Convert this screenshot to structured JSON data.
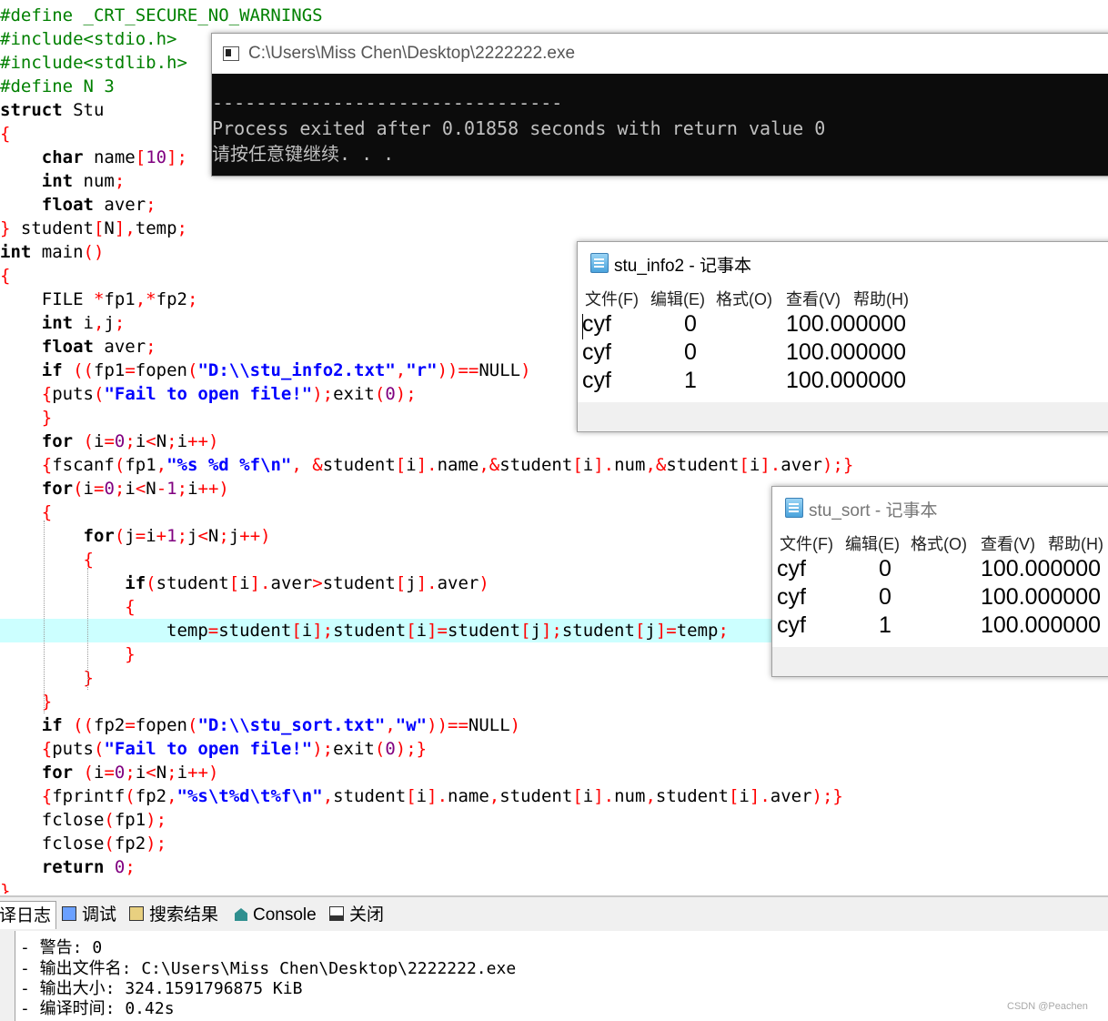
{
  "editor": {
    "highlight_line": 26,
    "lines": [
      [
        [
          "pre",
          "#define _CRT_SECURE_NO_WARNINGS"
        ]
      ],
      [
        [
          "pre",
          "#include<stdio.h>"
        ]
      ],
      [
        [
          "pre",
          "#include<stdlib.h>"
        ]
      ],
      [
        [
          "pre",
          "#define N 3"
        ]
      ],
      [
        [
          "kw",
          "struct"
        ],
        [
          "id",
          " Stu"
        ]
      ],
      [
        [
          "sym",
          "{"
        ]
      ],
      [
        [
          "id",
          "    "
        ],
        [
          "kw",
          "char"
        ],
        [
          "id",
          " name"
        ],
        [
          "sym",
          "["
        ],
        [
          "num",
          "10"
        ],
        [
          "sym",
          "];"
        ]
      ],
      [
        [
          "id",
          "    "
        ],
        [
          "kw",
          "int"
        ],
        [
          "id",
          " num"
        ],
        [
          "sym",
          ";"
        ]
      ],
      [
        [
          "id",
          "    "
        ],
        [
          "kw",
          "float"
        ],
        [
          "id",
          " aver"
        ],
        [
          "sym",
          ";"
        ]
      ],
      [
        [
          "sym",
          "}"
        ],
        [
          "id",
          " student"
        ],
        [
          "sym",
          "["
        ],
        [
          "id",
          "N"
        ],
        [
          "sym",
          "],"
        ],
        [
          "id",
          "temp"
        ],
        [
          "sym",
          ";"
        ]
      ],
      [
        [
          "kw",
          "int"
        ],
        [
          "id",
          " main"
        ],
        [
          "sym",
          "()"
        ]
      ],
      [
        [
          "sym",
          "{"
        ]
      ],
      [
        [
          "id",
          "    FILE "
        ],
        [
          "sym",
          "*"
        ],
        [
          "id",
          "fp1"
        ],
        [
          "sym",
          ",*"
        ],
        [
          "id",
          "fp2"
        ],
        [
          "sym",
          ";"
        ]
      ],
      [
        [
          "id",
          "    "
        ],
        [
          "kw",
          "int"
        ],
        [
          "id",
          " i"
        ],
        [
          "sym",
          ","
        ],
        [
          "id",
          "j"
        ],
        [
          "sym",
          ";"
        ]
      ],
      [
        [
          "id",
          "    "
        ],
        [
          "kw",
          "float"
        ],
        [
          "id",
          " aver"
        ],
        [
          "sym",
          ";"
        ]
      ],
      [
        [
          "id",
          "    "
        ],
        [
          "kw",
          "if"
        ],
        [
          "id",
          " "
        ],
        [
          "sym",
          "(("
        ],
        [
          "id",
          "fp1"
        ],
        [
          "sym",
          "="
        ],
        [
          "id",
          "fopen"
        ],
        [
          "sym",
          "("
        ],
        [
          "str",
          "\"D:\\\\stu_info2.txt\""
        ],
        [
          "sym",
          ","
        ],
        [
          "str",
          "\"r\""
        ],
        [
          "sym",
          "))=="
        ],
        [
          "id",
          "NULL"
        ],
        [
          "sym",
          ")"
        ]
      ],
      [
        [
          "id",
          "    "
        ],
        [
          "sym",
          "{"
        ],
        [
          "id",
          "puts"
        ],
        [
          "sym",
          "("
        ],
        [
          "str",
          "\"Fail to open file!\""
        ],
        [
          "sym",
          ");"
        ],
        [
          "id",
          "exit"
        ],
        [
          "sym",
          "("
        ],
        [
          "num",
          "0"
        ],
        [
          "sym",
          ");"
        ]
      ],
      [
        [
          "id",
          "    "
        ],
        [
          "sym",
          "}"
        ]
      ],
      [
        [
          "id",
          "    "
        ],
        [
          "kw",
          "for"
        ],
        [
          "id",
          " "
        ],
        [
          "sym",
          "("
        ],
        [
          "id",
          "i"
        ],
        [
          "sym",
          "="
        ],
        [
          "num",
          "0"
        ],
        [
          "sym",
          ";"
        ],
        [
          "id",
          "i"
        ],
        [
          "sym",
          "<"
        ],
        [
          "id",
          "N"
        ],
        [
          "sym",
          ";"
        ],
        [
          "id",
          "i"
        ],
        [
          "sym",
          "++)"
        ]
      ],
      [
        [
          "id",
          "    "
        ],
        [
          "sym",
          "{"
        ],
        [
          "id",
          "fscanf"
        ],
        [
          "sym",
          "("
        ],
        [
          "id",
          "fp1"
        ],
        [
          "sym",
          ","
        ],
        [
          "str",
          "\"%s %d %f\\n\""
        ],
        [
          "sym",
          ", &"
        ],
        [
          "id",
          "student"
        ],
        [
          "sym",
          "["
        ],
        [
          "id",
          "i"
        ],
        [
          "sym",
          "]."
        ],
        [
          "id",
          "name"
        ],
        [
          "sym",
          ",&"
        ],
        [
          "id",
          "student"
        ],
        [
          "sym",
          "["
        ],
        [
          "id",
          "i"
        ],
        [
          "sym",
          "]."
        ],
        [
          "id",
          "num"
        ],
        [
          "sym",
          ",&"
        ],
        [
          "id",
          "student"
        ],
        [
          "sym",
          "["
        ],
        [
          "id",
          "i"
        ],
        [
          "sym",
          "]."
        ],
        [
          "id",
          "aver"
        ],
        [
          "sym",
          ");}"
        ]
      ],
      [
        [
          "id",
          "    "
        ],
        [
          "kw",
          "for"
        ],
        [
          "sym",
          "("
        ],
        [
          "id",
          "i"
        ],
        [
          "sym",
          "="
        ],
        [
          "num",
          "0"
        ],
        [
          "sym",
          ";"
        ],
        [
          "id",
          "i"
        ],
        [
          "sym",
          "<"
        ],
        [
          "id",
          "N"
        ],
        [
          "sym",
          "-"
        ],
        [
          "num",
          "1"
        ],
        [
          "sym",
          ";"
        ],
        [
          "id",
          "i"
        ],
        [
          "sym",
          "++)"
        ]
      ],
      [
        [
          "id",
          "    "
        ],
        [
          "sym",
          "{"
        ]
      ],
      [
        [
          "id",
          "        "
        ],
        [
          "kw",
          "for"
        ],
        [
          "sym",
          "("
        ],
        [
          "id",
          "j"
        ],
        [
          "sym",
          "="
        ],
        [
          "id",
          "i"
        ],
        [
          "sym",
          "+"
        ],
        [
          "num",
          "1"
        ],
        [
          "sym",
          ";"
        ],
        [
          "id",
          "j"
        ],
        [
          "sym",
          "<"
        ],
        [
          "id",
          "N"
        ],
        [
          "sym",
          ";"
        ],
        [
          "id",
          "j"
        ],
        [
          "sym",
          "++)"
        ]
      ],
      [
        [
          "id",
          "        "
        ],
        [
          "sym",
          "{"
        ]
      ],
      [
        [
          "id",
          "            "
        ],
        [
          "kw",
          "if"
        ],
        [
          "sym",
          "("
        ],
        [
          "id",
          "student"
        ],
        [
          "sym",
          "["
        ],
        [
          "id",
          "i"
        ],
        [
          "sym",
          "]."
        ],
        [
          "id",
          "aver"
        ],
        [
          "sym",
          ">"
        ],
        [
          "id",
          "student"
        ],
        [
          "sym",
          "["
        ],
        [
          "id",
          "j"
        ],
        [
          "sym",
          "]."
        ],
        [
          "id",
          "aver"
        ],
        [
          "sym",
          ")"
        ]
      ],
      [
        [
          "id",
          "            "
        ],
        [
          "sym",
          "{"
        ]
      ],
      [
        [
          "id",
          "                temp"
        ],
        [
          "sym",
          "="
        ],
        [
          "id",
          "student"
        ],
        [
          "sym",
          "["
        ],
        [
          "id",
          "i"
        ],
        [
          "sym",
          "];"
        ],
        [
          "id",
          "student"
        ],
        [
          "sym",
          "["
        ],
        [
          "id",
          "i"
        ],
        [
          "sym",
          "]="
        ],
        [
          "id",
          "student"
        ],
        [
          "sym",
          "["
        ],
        [
          "id",
          "j"
        ],
        [
          "sym",
          "];"
        ],
        [
          "id",
          "student"
        ],
        [
          "sym",
          "["
        ],
        [
          "id",
          "j"
        ],
        [
          "sym",
          "]="
        ],
        [
          "id",
          "temp"
        ],
        [
          "sym",
          ";"
        ]
      ],
      [
        [
          "id",
          "            "
        ],
        [
          "sym",
          "}"
        ]
      ],
      [
        [
          "id",
          "        "
        ],
        [
          "sym",
          "}"
        ]
      ],
      [
        [
          "id",
          "    "
        ],
        [
          "sym",
          "}"
        ]
      ],
      [
        [
          "id",
          "    "
        ],
        [
          "kw",
          "if"
        ],
        [
          "id",
          " "
        ],
        [
          "sym",
          "(("
        ],
        [
          "id",
          "fp2"
        ],
        [
          "sym",
          "="
        ],
        [
          "id",
          "fopen"
        ],
        [
          "sym",
          "("
        ],
        [
          "str",
          "\"D:\\\\stu_sort.txt\""
        ],
        [
          "sym",
          ","
        ],
        [
          "str",
          "\"w\""
        ],
        [
          "sym",
          "))=="
        ],
        [
          "id",
          "NULL"
        ],
        [
          "sym",
          ")"
        ]
      ],
      [
        [
          "id",
          "    "
        ],
        [
          "sym",
          "{"
        ],
        [
          "id",
          "puts"
        ],
        [
          "sym",
          "("
        ],
        [
          "str",
          "\"Fail to open file!\""
        ],
        [
          "sym",
          ");"
        ],
        [
          "id",
          "exit"
        ],
        [
          "sym",
          "("
        ],
        [
          "num",
          "0"
        ],
        [
          "sym",
          ");}"
        ]
      ],
      [
        [
          "id",
          "    "
        ],
        [
          "kw",
          "for"
        ],
        [
          "id",
          " "
        ],
        [
          "sym",
          "("
        ],
        [
          "id",
          "i"
        ],
        [
          "sym",
          "="
        ],
        [
          "num",
          "0"
        ],
        [
          "sym",
          ";"
        ],
        [
          "id",
          "i"
        ],
        [
          "sym",
          "<"
        ],
        [
          "id",
          "N"
        ],
        [
          "sym",
          ";"
        ],
        [
          "id",
          "i"
        ],
        [
          "sym",
          "++)"
        ]
      ],
      [
        [
          "id",
          "    "
        ],
        [
          "sym",
          "{"
        ],
        [
          "id",
          "fprintf"
        ],
        [
          "sym",
          "("
        ],
        [
          "id",
          "fp2"
        ],
        [
          "sym",
          ","
        ],
        [
          "str",
          "\"%s\\t%d\\t%f\\n\""
        ],
        [
          "sym",
          ","
        ],
        [
          "id",
          "student"
        ],
        [
          "sym",
          "["
        ],
        [
          "id",
          "i"
        ],
        [
          "sym",
          "]."
        ],
        [
          "id",
          "name"
        ],
        [
          "sym",
          ","
        ],
        [
          "id",
          "student"
        ],
        [
          "sym",
          "["
        ],
        [
          "id",
          "i"
        ],
        [
          "sym",
          "]."
        ],
        [
          "id",
          "num"
        ],
        [
          "sym",
          ","
        ],
        [
          "id",
          "student"
        ],
        [
          "sym",
          "["
        ],
        [
          "id",
          "i"
        ],
        [
          "sym",
          "]."
        ],
        [
          "id",
          "aver"
        ],
        [
          "sym",
          ");}"
        ]
      ],
      [
        [
          "id",
          "    fclose"
        ],
        [
          "sym",
          "("
        ],
        [
          "id",
          "fp1"
        ],
        [
          "sym",
          ");"
        ]
      ],
      [
        [
          "id",
          "    fclose"
        ],
        [
          "sym",
          "("
        ],
        [
          "id",
          "fp2"
        ],
        [
          "sym",
          ");"
        ]
      ],
      [
        [
          "id",
          "    "
        ],
        [
          "kw",
          "return"
        ],
        [
          "id",
          " "
        ],
        [
          "num",
          "0"
        ],
        [
          "sym",
          ";"
        ]
      ],
      [
        [
          "sym",
          "}"
        ]
      ]
    ]
  },
  "console": {
    "title": "C:\\Users\\Miss Chen\\Desktop\\2222222.exe",
    "lines": [
      "--------------------------------",
      "Process exited after 0.01858 seconds with return value 0",
      "请按任意键继续. . ."
    ],
    "icon": "console-window-icon"
  },
  "notepad_info2": {
    "title": "stu_info2 - 记事本",
    "menu": [
      "文件(F)",
      "编辑(E)",
      "格式(O)",
      "查看(V)",
      "帮助(H)"
    ],
    "rows": [
      {
        "name": "cyf",
        "num": "0",
        "aver": "100.000000"
      },
      {
        "name": "cyf",
        "num": "0",
        "aver": "100.000000"
      },
      {
        "name": "cyf",
        "num": "1",
        "aver": "100.000000"
      }
    ],
    "title_color": "#000000"
  },
  "notepad_sort": {
    "title": "stu_sort - 记事本",
    "menu": [
      "文件(F)",
      "编辑(E)",
      "格式(O)",
      "查看(V)",
      "帮助(H)"
    ],
    "rows": [
      {
        "name": "cyf",
        "num": "0",
        "aver": "100.000000"
      },
      {
        "name": "cyf",
        "num": "0",
        "aver": "100.000000"
      },
      {
        "name": "cyf",
        "num": "1",
        "aver": "100.000000"
      }
    ],
    "title_color": "#777777"
  },
  "bottom_tabs": [
    {
      "label": "译日志",
      "icon": "",
      "active": true
    },
    {
      "label": "调试",
      "icon": "debug-icon",
      "active": false
    },
    {
      "label": "搜索结果",
      "icon": "search-results-icon",
      "active": false
    },
    {
      "label": "Console",
      "icon": "console-icon",
      "active": false
    },
    {
      "label": "关闭",
      "icon": "close-icon",
      "active": false
    }
  ],
  "compile_log": [
    "- 警告: 0",
    "- 输出文件名: C:\\Users\\Miss Chen\\Desktop\\2222222.exe",
    "- 输出大小: 324.1591796875 KiB",
    "- 编译时间: 0.42s"
  ],
  "watermark": "CSDN @Peachen",
  "colors": {
    "preprocessor": "#008000",
    "keyword": "#000000",
    "string": "#0000ff",
    "number": "#800080",
    "symbol": "#ff0000",
    "highlight": "#ccffff",
    "console_bg": "#0c0c0c",
    "console_fg": "#c0c0c0"
  }
}
